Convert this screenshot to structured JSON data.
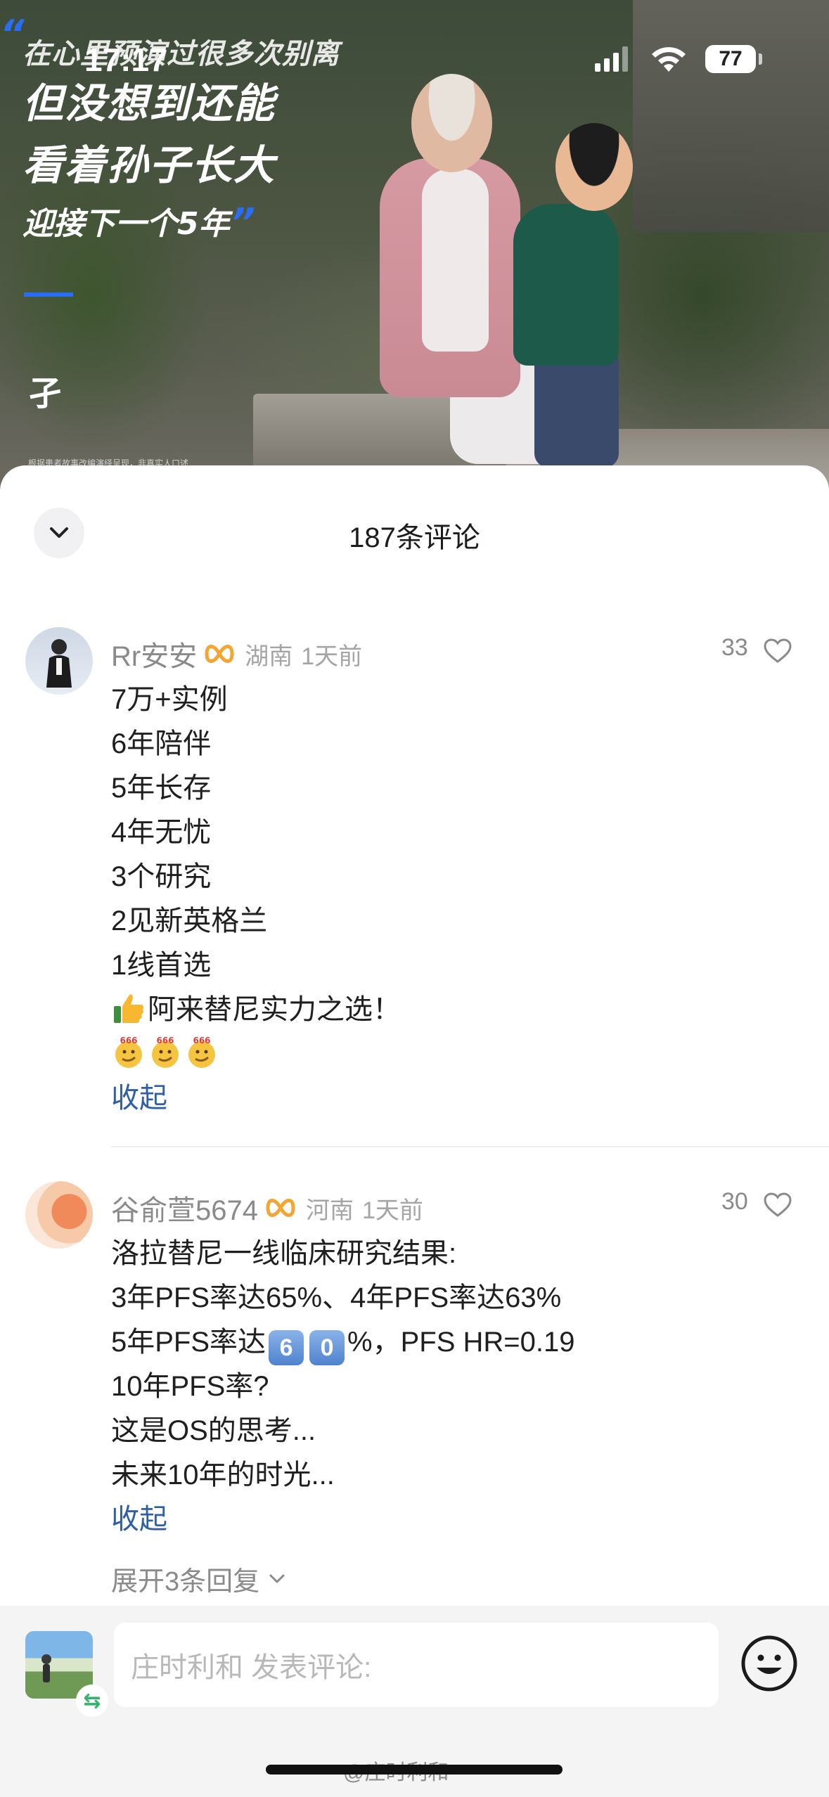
{
  "status_bar": {
    "time": "17:17",
    "battery": "77"
  },
  "video": {
    "quote_line1": "在心里预演过很多次别离",
    "quote_line2": "但没想到还能",
    "quote_line3": "看着孙子长大",
    "quote_line4": "迎接下一个5年",
    "subtitle_fragment": "孑",
    "fine_print": "根据患者故事改编演绎呈现，非真实人口述",
    "accent_color": "#2b6df0"
  },
  "sheet": {
    "title": "187条评论",
    "collapse_icon": "chevron-down-icon"
  },
  "comments": [
    {
      "user": "Rr安安",
      "badge_icon": "infinity-badge-icon",
      "location": "湖南",
      "time": "1天前",
      "likes": "33",
      "lines": [
        "7万+实例",
        "6年陪伴",
        "5年长存",
        "4年无忧",
        "3个研究",
        "2见新英格兰",
        "1线首选",
        "阿来替尼实力之选！",
        ""
      ],
      "thumbs_icon": "thumbs-up-emoji",
      "emoji_666": "666-emoji",
      "collapse_label": "收起"
    },
    {
      "user": "谷俞萱5674",
      "badge_icon": "infinity-badge-icon",
      "location": "河南",
      "time": "1天前",
      "likes": "30",
      "lines": [
        "洛拉替尼一线临床研究结果:",
        "3年PFS率达65%、4年PFS率达63%",
        "5年PFS率达",
        "10年PFS率?",
        "这是OS的思考...",
        "未来10年的时光..."
      ],
      "keycap_6": "6",
      "keycap_0": "0",
      "line3_suffix": "%，PFS HR=0.19",
      "collapse_label": "收起",
      "expand_replies": "展开3条回复"
    }
  ],
  "bottom_bar": {
    "input_placeholder": "庄时利和 发表评论:",
    "swap_icon": "⇆",
    "emoji_icon": "smiley-icon"
  },
  "watermark": "@庄时利和"
}
